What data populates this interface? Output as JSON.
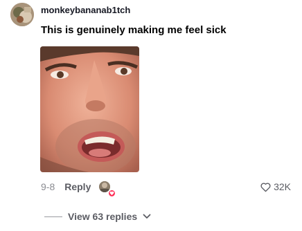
{
  "comment": {
    "username": "monkeybananab1tch",
    "text": "This is genuinely making me feel sick",
    "image_icon": "face-photo",
    "date": "9-8",
    "reply_label": "Reply",
    "likes": "32K",
    "like_icon": "heart-outline-icon",
    "creator_liked_icon": "heart-badge-icon"
  },
  "replies": {
    "label": "View 63 replies",
    "icon": "chevron-down-icon"
  },
  "colors": {
    "accent": "#fe2c55",
    "text_primary": "#161823",
    "text_secondary": "#5b5c63",
    "text_muted": "#8a8b91"
  }
}
